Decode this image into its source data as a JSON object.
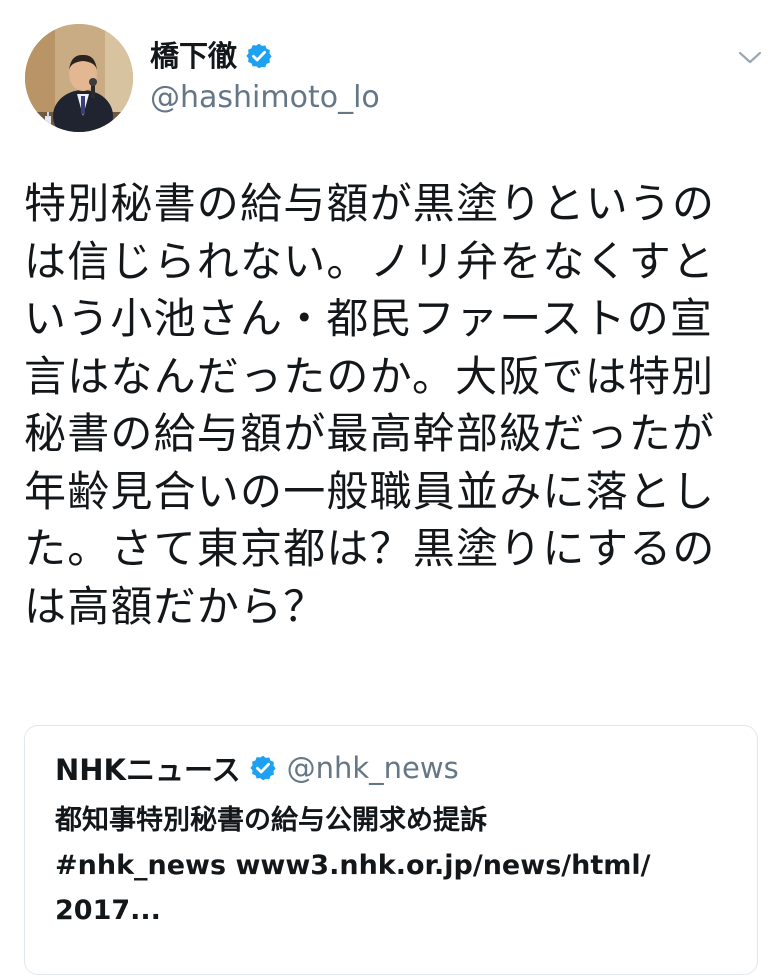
{
  "tweet": {
    "display_name": "橋下徹",
    "handle": "@hashimoto_lo",
    "text": "特別秘書の給与額が黒塗りというの\nは信じられない。ノリ弁をなくすと\nいう小池さん・都民ファーストの宣\n言はなんだったのか。大阪では特別\n秘書の給与額が最高幹部級だったが\n年齢見合いの一般職員並みに落とし\nた。さて東京都は？黒塗りにするの\nは高額だから？",
    "verified_icon": "verified-badge-icon",
    "menu_icon": "chevron-down-icon"
  },
  "quote": {
    "display_name": "NHKニュース",
    "handle": "@nhk_news",
    "text": "都知事特別秘書の給与公開求め提訴\n#nhk_news www3.nhk.or.jp/news/html/\n2017...",
    "verified_icon": "verified-badge-icon"
  },
  "colors": {
    "text_primary": "#14171a",
    "text_secondary": "#657786",
    "verified_blue": "#1da1f2",
    "card_border": "#e1e8ed"
  }
}
